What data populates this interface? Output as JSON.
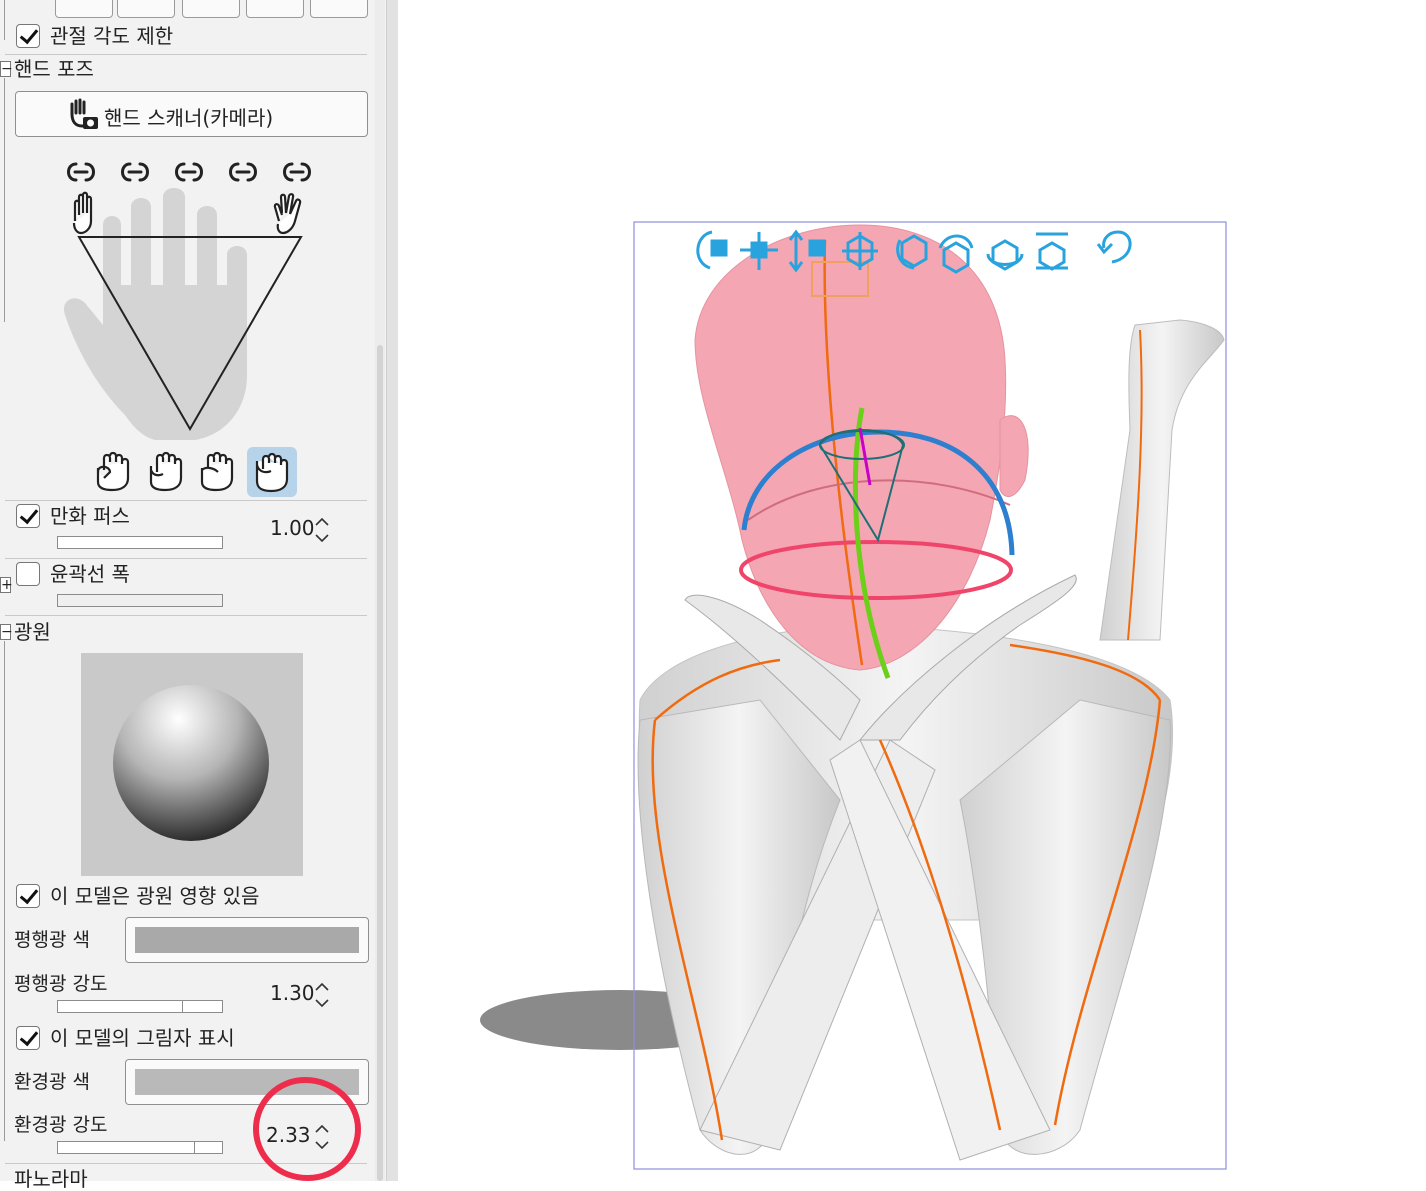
{
  "panel": {
    "joint_limit": {
      "label": "관절 각도 제한",
      "checked": true
    },
    "hand_pose": {
      "section_label": "핸드 포즈",
      "scanner_button": "핸드 스캐너(카메라)",
      "link_icons": [
        "link-icon",
        "link-icon",
        "link-icon",
        "link-icon",
        "link-icon"
      ],
      "grip_presets": [
        "fist-icon",
        "fist-icon",
        "fist-icon",
        "fist-icon"
      ],
      "active_preset_index": 3
    },
    "manga_perspective": {
      "label": "만화 퍼스",
      "checked": true,
      "value": "1.00"
    },
    "outline_width": {
      "label": "윤곽선 폭",
      "checked": false
    },
    "light": {
      "section_label": "광원",
      "affected": {
        "label": "이 모델은 광원 영향 있음",
        "checked": true
      },
      "directional_color": {
        "label": "평행광 색",
        "color": "#a9a9a9"
      },
      "directional_intensity": {
        "label": "평행광 강도",
        "value": "1.30",
        "fill": 0.75
      },
      "show_shadow": {
        "label": "이 모델의 그림자 표시",
        "checked": true
      },
      "ambient_color": {
        "label": "환경광 색",
        "color": "#b9b9b9"
      },
      "ambient_intensity": {
        "label": "환경광 강도",
        "value": "2.33",
        "fill": 0.82
      }
    },
    "panorama": {
      "label": "파노라마"
    }
  },
  "viewport": {
    "manipulator_icons": [
      "rotate-camera-icon",
      "pan-camera-icon",
      "zoom-camera-icon",
      "move-model-icon",
      "rotate-model-icon",
      "rotate-y-icon",
      "rotate-x-icon",
      "place-on-floor-icon",
      "undo-icon"
    ],
    "accent": "#29a3dd"
  },
  "annotation": {
    "color": "#ee2d4c"
  }
}
